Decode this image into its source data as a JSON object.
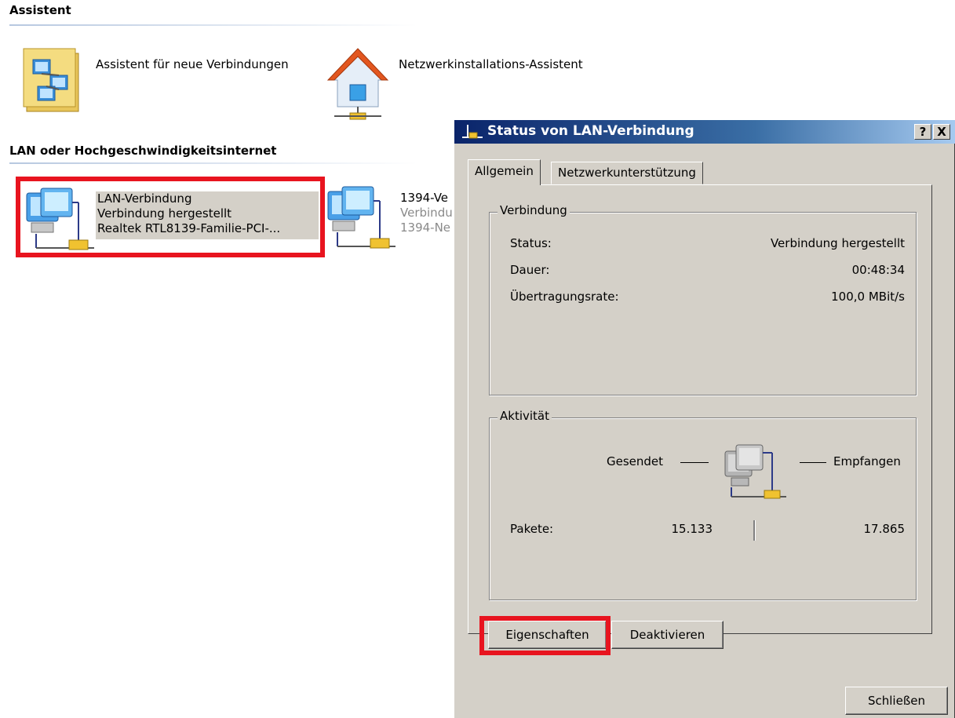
{
  "folder": {
    "groups": [
      {
        "title": "Assistent"
      },
      {
        "title": "LAN oder Hochgeschwindigkeitsinternet"
      }
    ],
    "wizards": [
      {
        "label": "Assistent für neue Verbindungen",
        "icon": "new-connection-wizard-icon"
      },
      {
        "label": "Netzwerkinstallations-Assistent",
        "icon": "network-setup-house-icon"
      }
    ],
    "connections": [
      {
        "name": "LAN-Verbindung",
        "status": "Verbindung hergestellt",
        "device": "Realtek RTL8139-Familie-PCI-...",
        "icon": "lan-connection-icon",
        "selected": true
      },
      {
        "name": "1394-Ve",
        "status": "Verbindu",
        "device": "1394-Ne",
        "icon": "lan-connection-icon",
        "selected": false
      }
    ]
  },
  "dialog": {
    "title": "Status von LAN-Verbindung",
    "help_button": "?",
    "close_button": "X",
    "tabs": [
      {
        "label": "Allgemein",
        "active": true
      },
      {
        "label": "Netzwerkunterstützung",
        "active": false
      }
    ],
    "connection_group": {
      "legend": "Verbindung",
      "rows": [
        {
          "label": "Status:",
          "value": "Verbindung hergestellt"
        },
        {
          "label": "Dauer:",
          "value": "00:48:34"
        },
        {
          "label": "Übertragungsrate:",
          "value": "100,0 MBit/s"
        }
      ]
    },
    "activity_group": {
      "legend": "Aktivität",
      "sent_label": "Gesendet",
      "received_label": "Empfangen",
      "packets_label": "Pakete:",
      "packets_sent": "15.133",
      "packets_received": "17.865"
    },
    "buttons": {
      "properties": "Eigenschaften",
      "disable": "Deaktivieren",
      "close": "Schließen"
    }
  },
  "highlight_color": "#e8141f",
  "titlebar_color": "#0a246a"
}
